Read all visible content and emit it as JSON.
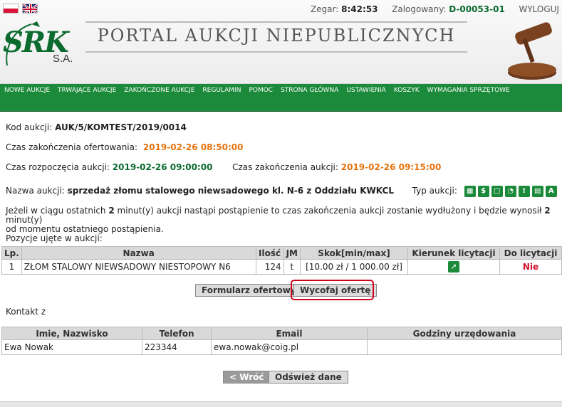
{
  "header": {
    "languages": [
      "pl",
      "en"
    ],
    "clock_label": "Zegar:",
    "clock_value": "8:42:53",
    "logged_label": "Zalogowany:",
    "logged_value": "D-00053-01",
    "logout_label": "WYLOGUJ",
    "logo_text": "SRK",
    "logo_suffix": "S.A.",
    "portal_title": "PORTAL AUKCJI NIEPUBLICZNYCH"
  },
  "nav": {
    "items": [
      "NOWE AUKCJE",
      "TRWAJĄCE AUKCJE",
      "ZAKOŃCZONE AUKCJE",
      "REGULAMIN",
      "POMOC",
      "STRONA GŁÓWNA",
      "USTAWIENIA",
      "KOSZYK",
      "WYMAGANIA SPRZĘTOWE"
    ]
  },
  "auction": {
    "code_label": "Kod aukcji:",
    "code_value": "AUK/5/KOMTEST/2019/0014",
    "offer_end_label": "Czas zakończenia ofertowania:",
    "offer_end_value": "2019-02-26 08:50:00",
    "start_label": "Czas rozpoczęcia aukcji:",
    "start_value": "2019-02-26 09:00:00",
    "end_label": "Czas zakończenia aukcji:",
    "end_value": "2019-02-26 09:15:00",
    "name_label": "Nazwa aukcji:",
    "name_value": "sprzedaż złomu stalowego niewsadowego kl. N-6 z Oddziału KWKCL",
    "type_label": "Typ aukcji:",
    "type_icons": [
      "grid-icon",
      "dollar-icon",
      "lock-icon",
      "clock-icon",
      "exclamation-icon",
      "document-icon",
      "letter-a-icon"
    ],
    "info_line1_a": "Jeżeli w ciągu ostatnich ",
    "info_line1_b": "2",
    "info_line1_c": " minut(y) aukcji nastąpi postąpienie to czas zakończenia aukcji zostanie wydłużony i będzie wynosił ",
    "info_line1_d": "2",
    "info_line1_e": " minut(y)",
    "info_line2": "od momentu ostatniego postąpienia.",
    "positions_label": "Pozycje ujęte w aukcji:"
  },
  "items_table": {
    "headers": [
      "Lp.",
      "Nazwa",
      "Ilość",
      "JM",
      "Skok[min/max]",
      "Kierunek licytacji",
      "Do licytacji"
    ],
    "rows": [
      {
        "lp": "1",
        "nazwa": "ZŁOM STALOWY NIEWSADOWY NIESTOPOWY N6",
        "ilosc": "124",
        "jm": "t",
        "skok": "[10.00 zł / 1 000.00 zł]",
        "kierunek_icon": "arrow-up-right-icon",
        "do_licytacji": "Nie"
      }
    ]
  },
  "actions": {
    "offer_form": "Formularz ofertowy",
    "withdraw": "Wycofaj ofertę"
  },
  "contact": {
    "label": "Kontakt z",
    "headers": [
      "Imie, Nazwisko",
      "Telefon",
      "Email",
      "Godziny urzędowania"
    ],
    "rows": [
      {
        "name": "Ewa Nowak",
        "phone": "223344",
        "email": "ewa.nowak@coig.pl",
        "hours": ""
      }
    ]
  },
  "footer": {
    "back": "< Wróć",
    "refresh": "Odśwież dane"
  },
  "colors": {
    "brand_green": "#1c8a3b",
    "date_orange": "#e8720c",
    "status_red": "#d2122b",
    "highlight_red": "#d0021b"
  }
}
